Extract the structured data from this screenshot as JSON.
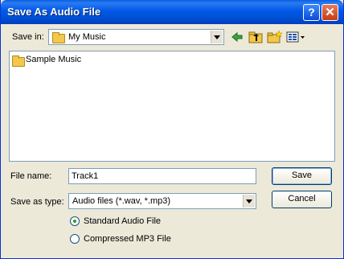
{
  "window": {
    "title": "Save As Audio File",
    "help_symbol": "?",
    "close_symbol": "✕"
  },
  "save_in": {
    "label": "Save in:",
    "value": "My Music"
  },
  "toolbar_icons": [
    "back-arrow-icon",
    "up-folder-icon",
    "new-folder-icon",
    "view-menu-icon"
  ],
  "list": {
    "items": [
      {
        "label": "Sample Music"
      }
    ]
  },
  "file_name": {
    "label": "File name:",
    "value": "Track1"
  },
  "save_type": {
    "label": "Save as type:",
    "value": "Audio files (*.wav, *.mp3)"
  },
  "buttons": {
    "save": "Save",
    "cancel": "Cancel"
  },
  "format": {
    "options": [
      {
        "label": "Standard Audio File",
        "selected": true
      },
      {
        "label": "Compressed MP3 File",
        "selected": false
      }
    ]
  },
  "colors": {
    "title_bar": "#0058e6",
    "dialog_bg": "#ece9d8",
    "close_button": "#c53d13"
  }
}
